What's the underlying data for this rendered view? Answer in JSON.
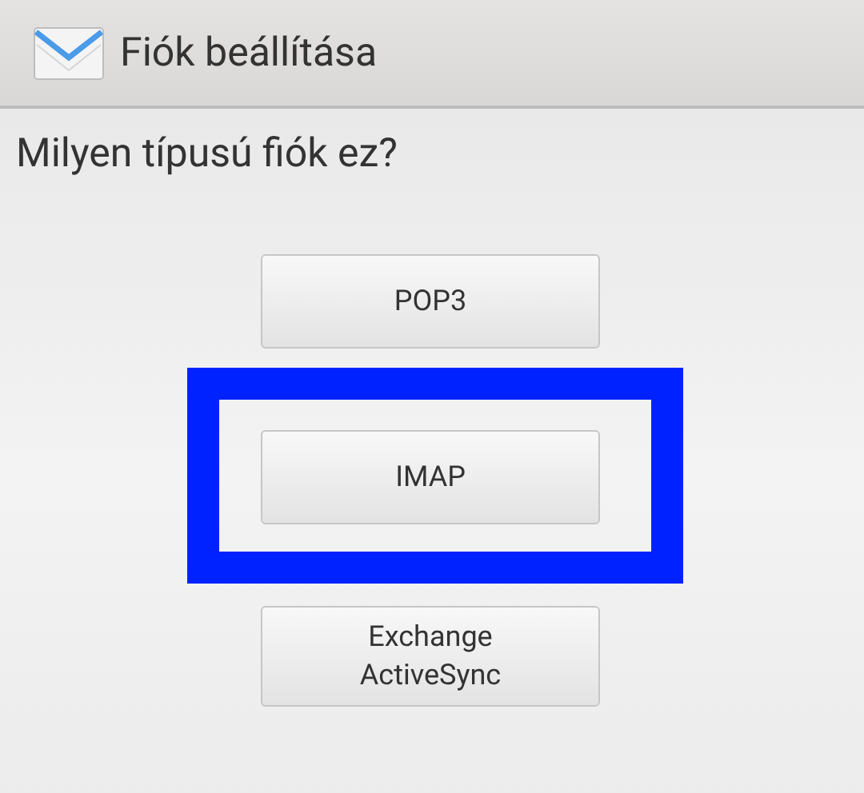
{
  "action_bar": {
    "title": "Fiók beállítása"
  },
  "question": "Milyen típusú fiók ez?",
  "buttons": [
    {
      "label": "POP3",
      "highlighted": false
    },
    {
      "label": "IMAP",
      "highlighted": true
    },
    {
      "label": "Exchange\nActiveSync",
      "highlighted": false
    }
  ]
}
